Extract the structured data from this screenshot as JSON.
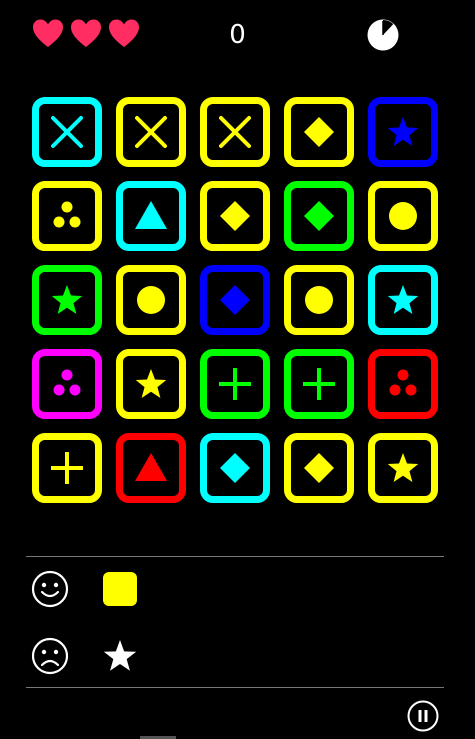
{
  "hud": {
    "lives": 3,
    "score": "0",
    "timer_remaining": 0.88,
    "heart_color": "#ff2d62"
  },
  "colors": {
    "cyan": "#00ffff",
    "yellow": "#ffff00",
    "blue": "#0000ff",
    "green": "#00ff00",
    "magenta": "#ff00ff",
    "red": "#ff0000"
  },
  "board": [
    [
      {
        "color": "cyan",
        "symbol": "x"
      },
      {
        "color": "yellow",
        "symbol": "x"
      },
      {
        "color": "yellow",
        "symbol": "x"
      },
      {
        "color": "yellow",
        "symbol": "diamond"
      },
      {
        "color": "blue",
        "symbol": "star"
      }
    ],
    [
      {
        "color": "yellow",
        "symbol": "dots"
      },
      {
        "color": "cyan",
        "symbol": "triangle"
      },
      {
        "color": "yellow",
        "symbol": "diamond"
      },
      {
        "color": "green",
        "symbol": "diamond"
      },
      {
        "color": "yellow",
        "symbol": "circle"
      }
    ],
    [
      {
        "color": "green",
        "symbol": "star"
      },
      {
        "color": "yellow",
        "symbol": "circle"
      },
      {
        "color": "blue",
        "symbol": "diamond"
      },
      {
        "color": "yellow",
        "symbol": "circle"
      },
      {
        "color": "cyan",
        "symbol": "star"
      }
    ],
    [
      {
        "color": "magenta",
        "symbol": "dots"
      },
      {
        "color": "yellow",
        "symbol": "star"
      },
      {
        "color": "green",
        "symbol": "plus"
      },
      {
        "color": "green",
        "symbol": "plus"
      },
      {
        "color": "red",
        "symbol": "dots"
      }
    ],
    [
      {
        "color": "yellow",
        "symbol": "plus"
      },
      {
        "color": "red",
        "symbol": "triangle"
      },
      {
        "color": "cyan",
        "symbol": "diamond"
      },
      {
        "color": "yellow",
        "symbol": "diamond"
      },
      {
        "color": "yellow",
        "symbol": "star"
      }
    ]
  ],
  "rules": {
    "good": {
      "face": "smiley-face-icon",
      "indicator": "square",
      "color": "yellow"
    },
    "bad": {
      "face": "sad-face-icon",
      "indicator": "star",
      "color": "white"
    }
  },
  "controls": {
    "pause": "pause-icon"
  }
}
